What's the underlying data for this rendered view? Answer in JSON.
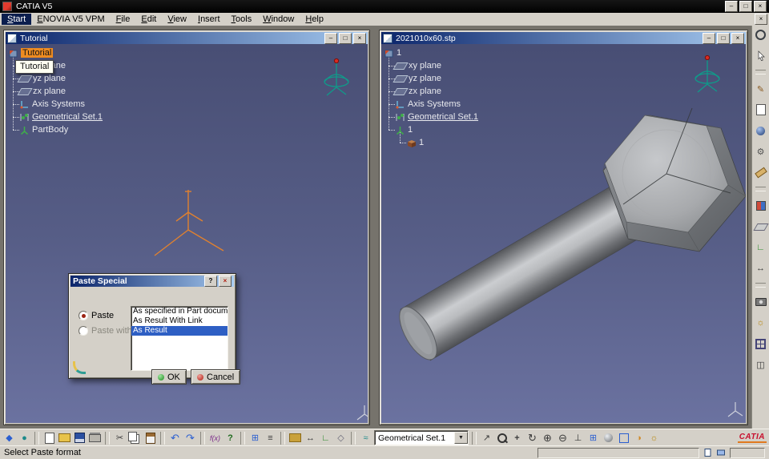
{
  "app": {
    "title": "CATIA V5"
  },
  "menubar": {
    "items": [
      "Start",
      "ENOVIA V5 VPM",
      "File",
      "Edit",
      "View",
      "Insert",
      "Tools",
      "Window",
      "Help"
    ]
  },
  "left_window": {
    "title": "Tutorial",
    "tooltip": "Tutorial",
    "tree": {
      "root": "Tutorial",
      "items": [
        "xy plane",
        "yz plane",
        "zx plane",
        "Axis Systems",
        "Geometrical Set.1",
        "PartBody"
      ]
    }
  },
  "right_window": {
    "title": "2021010x60.stp",
    "tree": {
      "root": "1",
      "items": [
        "xy plane",
        "yz plane",
        "zx plane",
        "Axis Systems",
        "Geometrical Set.1",
        "1",
        "1"
      ]
    }
  },
  "paste_dialog": {
    "title": "Paste Special",
    "paste_label": "Paste",
    "paste_with_link_label": "Paste with link",
    "options": [
      "As specified in Part document",
      "As Result With Link",
      "As Result"
    ],
    "selected_option": "As Result",
    "ok_label": "OK",
    "cancel_label": "Cancel"
  },
  "bottom_toolbar": {
    "combo_value": "Geometrical Set.1",
    "icons": [
      "workbench-icon",
      "browser-icon",
      "new-document-icon",
      "open-folder-icon",
      "save-icon",
      "print-icon",
      "cut-icon",
      "copy-icon",
      "paste-icon",
      "undo-icon",
      "redo-icon",
      "formula-icon",
      "knowledge-icon",
      "graph-icon",
      "list-icon",
      "catalog-icon",
      "measure-icon",
      "axes-icon",
      "plane-icon",
      "link-icon",
      "fly-icon",
      "fit-all-icon",
      "pan-icon",
      "rotate-icon",
      "zoom-in-icon",
      "zoom-out-icon",
      "normal-view-icon",
      "multi-view-icon",
      "shaded-view-icon",
      "wireframe-view-icon",
      "hide-show-icon",
      "light-icon"
    ]
  },
  "right_toolbar": {
    "icons": [
      "render-style-icon",
      "select-arrow-icon",
      "pencil-icon",
      "sheet-icon",
      "sphere-icon",
      "gear-icon",
      "ruler-icon",
      "paint-icon",
      "plane-icon",
      "axis-icon",
      "measure-icon",
      "camera-icon",
      "bulb-icon",
      "grid-icon",
      "layers-icon"
    ]
  },
  "statusbar": {
    "message": "Select Paste format"
  },
  "brand": {
    "logo_text": "CATIA"
  },
  "colors": {
    "chrome": "#d4d0c8",
    "titlebar_gradient_start": "#0a246a",
    "titlebar_gradient_end": "#a6caf0",
    "viewport_top": "#484e74",
    "viewport_bottom": "#6b72a0",
    "selection_orange": "#ee8b21",
    "list_selection_blue": "#2e5fc4",
    "compass_teal": "#0f9b8a",
    "axis_orange": "#e0812f"
  }
}
